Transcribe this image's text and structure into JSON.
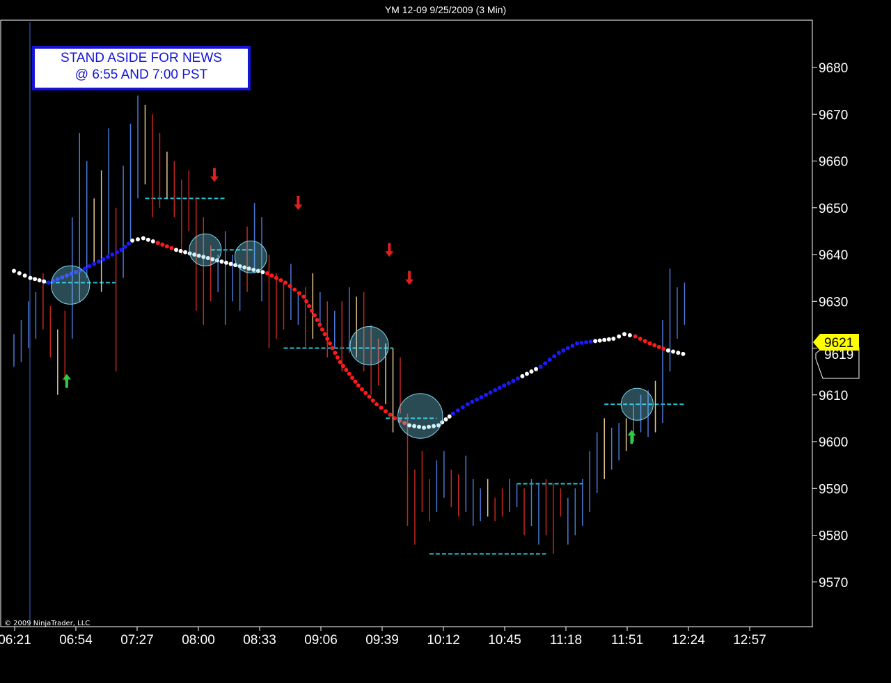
{
  "header": {
    "title": "YM 12-09  9/25/2009 (3 Min)"
  },
  "annotation": {
    "line1": "STAND ASIDE FOR NEWS",
    "line2": "@ 6:55 AND 7:00 PST"
  },
  "copyright": "© 2009 NinjaTrader, LLC",
  "price_tags": {
    "last": "9621",
    "secondary": "9619"
  },
  "colors": {
    "background": "#000000",
    "up_bar": "#4a78d8",
    "down_bar": "#c4281c",
    "neutral_bar": "#e8c890",
    "ma_up": "#1a1aff",
    "ma_down": "#ff1a1a",
    "ma_flat": "#ffffff",
    "level_line": "#1fc8d8",
    "circle": "#7ad8f0",
    "buy_arrow": "#2ecc40",
    "sell_arrow": "#e02020",
    "price_tag": "#ffff00"
  },
  "chart_data": {
    "type": "bar",
    "title": "YM 12-09  9/25/2009 (3 Min)",
    "x_ticks": [
      "06:21",
      "06:54",
      "07:27",
      "08:00",
      "08:33",
      "09:06",
      "09:39",
      "10:12",
      "10:45",
      "11:18",
      "11:51",
      "12:24",
      "12:57"
    ],
    "y_ticks": [
      9570,
      9580,
      9590,
      9600,
      9610,
      9620,
      9630,
      9640,
      9650,
      9660,
      9670,
      9680
    ],
    "ylim": [
      9560,
      9690
    ],
    "xlim_minutes": [
      381,
      805
    ],
    "grid": false,
    "moving_average": {
      "points": [
        [
          381,
          9636.5
        ],
        [
          390,
          9635
        ],
        [
          400,
          9634
        ],
        [
          410,
          9635.5
        ],
        [
          420,
          9637
        ],
        [
          430,
          9639
        ],
        [
          440,
          9641
        ],
        [
          446,
          9643
        ],
        [
          452,
          9643.5
        ],
        [
          460,
          9642.5
        ],
        [
          470,
          9641
        ],
        [
          480,
          9640
        ],
        [
          490,
          9639
        ],
        [
          500,
          9638
        ],
        [
          510,
          9637
        ],
        [
          520,
          9636
        ],
        [
          530,
          9634
        ],
        [
          540,
          9631
        ],
        [
          546,
          9627
        ],
        [
          553,
          9622
        ],
        [
          560,
          9617
        ],
        [
          570,
          9612
        ],
        [
          580,
          9608
        ],
        [
          590,
          9605
        ],
        [
          598,
          9603.5
        ],
        [
          606,
          9603
        ],
        [
          614,
          9603.5
        ],
        [
          622,
          9606
        ],
        [
          630,
          9608
        ],
        [
          640,
          9610
        ],
        [
          650,
          9612
        ],
        [
          660,
          9614
        ],
        [
          670,
          9616
        ],
        [
          680,
          9619
        ],
        [
          690,
          9621
        ],
        [
          700,
          9621.5
        ],
        [
          710,
          9622
        ],
        [
          716,
          9623
        ],
        [
          722,
          9622.5
        ],
        [
          730,
          9621
        ],
        [
          740,
          9619.5
        ],
        [
          751,
          9618.5
        ]
      ],
      "segment_colors": [
        "ma_flat",
        "ma_flat",
        "ma_up",
        "ma_up",
        "ma_up",
        "ma_up",
        "ma_up",
        "ma_flat",
        "ma_flat",
        "ma_down",
        "ma_flat",
        "ma_flat",
        "ma_flat",
        "ma_flat",
        "ma_flat",
        "ma_down",
        "ma_down",
        "ma_down",
        "ma_down",
        "ma_down",
        "ma_down",
        "ma_down",
        "ma_down",
        "ma_down",
        "ma_flat",
        "ma_flat",
        "ma_flat",
        "ma_up",
        "ma_up",
        "ma_up",
        "ma_up",
        "ma_flat",
        "ma_up",
        "ma_up",
        "ma_up",
        "ma_flat",
        "ma_flat",
        "ma_flat",
        "ma_down",
        "ma_down",
        "ma_flat",
        "ma_flat"
      ]
    },
    "bars": [
      [
        381,
        9616,
        9623,
        "up"
      ],
      [
        385,
        9617,
        9626,
        "up"
      ],
      [
        389,
        9620,
        9630,
        "up"
      ],
      [
        393,
        9622,
        9632,
        "up"
      ],
      [
        397,
        9624,
        9636,
        "down"
      ],
      [
        401,
        9618,
        9629,
        "down"
      ],
      [
        405,
        9610,
        9624,
        "neutral"
      ],
      [
        409,
        9613,
        9628,
        "down"
      ],
      [
        413,
        9622,
        9648,
        "up"
      ],
      [
        417,
        9630,
        9666,
        "up"
      ],
      [
        421,
        9635,
        9660,
        "up"
      ],
      [
        425,
        9638,
        9652,
        "neutral"
      ],
      [
        429,
        9632,
        9658,
        "neutral"
      ],
      [
        433,
        9640,
        9667,
        "up"
      ],
      [
        437,
        9615,
        9650,
        "down"
      ],
      [
        441,
        9635,
        9659,
        "up"
      ],
      [
        445,
        9643,
        9668,
        "up"
      ],
      [
        449,
        9652,
        9674,
        "up"
      ],
      [
        453,
        9655,
        9672,
        "neutral"
      ],
      [
        457,
        9648,
        9670,
        "down"
      ],
      [
        461,
        9650,
        9666,
        "down"
      ],
      [
        465,
        9652,
        9662,
        "neutral"
      ],
      [
        469,
        9648,
        9660,
        "down"
      ],
      [
        473,
        9640,
        9656,
        "down"
      ],
      [
        477,
        9645,
        9658,
        "down"
      ],
      [
        481,
        9628,
        9652,
        "down"
      ],
      [
        485,
        9625,
        9648,
        "down"
      ],
      [
        489,
        9630,
        9642,
        "down"
      ],
      [
        493,
        9632,
        9640,
        "up"
      ],
      [
        497,
        9625,
        9645,
        "up"
      ],
      [
        501,
        9630,
        9640,
        "up"
      ],
      [
        505,
        9628,
        9638,
        "up"
      ],
      [
        509,
        9632,
        9646,
        "down"
      ],
      [
        513,
        9636,
        9651,
        "up"
      ],
      [
        517,
        9630,
        9648,
        "up"
      ],
      [
        521,
        9620,
        9640,
        "down"
      ],
      [
        525,
        9622,
        9636,
        "down"
      ],
      [
        529,
        9624,
        9634,
        "down"
      ],
      [
        533,
        9626,
        9638,
        "up"
      ],
      [
        537,
        9625,
        9632,
        "up"
      ],
      [
        541,
        9620,
        9633,
        "down"
      ],
      [
        545,
        9622,
        9636,
        "neutral"
      ],
      [
        549,
        9625,
        9632,
        "up"
      ],
      [
        553,
        9618,
        9630,
        "down"
      ],
      [
        557,
        9620,
        9628,
        "up"
      ],
      [
        561,
        9615,
        9630,
        "down"
      ],
      [
        565,
        9619,
        9633,
        "up"
      ],
      [
        569,
        9618,
        9631,
        "neutral"
      ],
      [
        573,
        9615,
        9632,
        "down"
      ],
      [
        577,
        9610,
        9625,
        "down"
      ],
      [
        581,
        9612,
        9622,
        "down"
      ],
      [
        585,
        9608,
        9621,
        "neutral"
      ],
      [
        589,
        9602,
        9620,
        "neutral"
      ],
      [
        593,
        9606,
        9618,
        "down"
      ],
      [
        597,
        9582,
        9606,
        "down"
      ],
      [
        601,
        9578,
        9594,
        "down"
      ],
      [
        605,
        9585,
        9598,
        "down"
      ],
      [
        609,
        9583,
        9592,
        "down"
      ],
      [
        613,
        9585,
        9596,
        "up"
      ],
      [
        617,
        9588,
        9598,
        "up"
      ],
      [
        621,
        9586,
        9594,
        "down"
      ],
      [
        625,
        9584,
        9593,
        "down"
      ],
      [
        629,
        9585,
        9597,
        "up"
      ],
      [
        633,
        9582,
        9592,
        "up"
      ],
      [
        637,
        9583,
        9590,
        "up"
      ],
      [
        641,
        9584,
        9592,
        "neutral"
      ],
      [
        645,
        9583,
        9588,
        "down"
      ],
      [
        649,
        9584,
        9590,
        "down"
      ],
      [
        653,
        9585,
        9592,
        "up"
      ],
      [
        657,
        9586,
        9591,
        "up"
      ],
      [
        661,
        9580,
        9590,
        "down"
      ],
      [
        665,
        9582,
        9592,
        "up"
      ],
      [
        669,
        9578,
        9591,
        "up"
      ],
      [
        673,
        9580,
        9592,
        "down"
      ],
      [
        677,
        9576,
        9591,
        "down"
      ],
      [
        681,
        9584,
        9590,
        "down"
      ],
      [
        685,
        9578,
        9588,
        "up"
      ],
      [
        689,
        9580,
        9590,
        "up"
      ],
      [
        693,
        9582,
        9592,
        "up"
      ],
      [
        697,
        9585,
        9598,
        "up"
      ],
      [
        701,
        9589,
        9602,
        "up"
      ],
      [
        705,
        9592,
        9605,
        "neutral"
      ],
      [
        709,
        9594,
        9603,
        "up"
      ],
      [
        713,
        9596,
        9604,
        "up"
      ],
      [
        717,
        9598,
        9605,
        "neutral"
      ],
      [
        721,
        9600,
        9608,
        "up"
      ],
      [
        725,
        9602,
        9610,
        "up"
      ],
      [
        729,
        9601,
        9611,
        "up"
      ],
      [
        733,
        9602,
        9613,
        "neutral"
      ],
      [
        737,
        9604,
        9626,
        "up"
      ],
      [
        741,
        9615,
        9637,
        "up"
      ],
      [
        745,
        9622,
        9633,
        "up"
      ],
      [
        749,
        9625,
        9634,
        "up"
      ]
    ],
    "levels": [
      [
        397,
        9634,
        437
      ],
      [
        453,
        9652,
        497
      ],
      [
        489,
        9641,
        513
      ],
      [
        529,
        9620,
        589
      ],
      [
        585,
        9605,
        613
      ],
      [
        609,
        9576,
        673
      ],
      [
        657,
        9591,
        693
      ],
      [
        705,
        9608,
        749
      ]
    ],
    "circles": [
      [
        412,
        9633.5,
        12
      ],
      [
        486,
        9641,
        10
      ],
      [
        511,
        9639.5,
        10
      ],
      [
        576,
        9620.5,
        12
      ],
      [
        604,
        9605.5,
        14
      ],
      [
        723,
        9608,
        10
      ]
    ],
    "buy_arrows": [
      [
        410,
        9613
      ],
      [
        720,
        9601
      ]
    ],
    "sell_arrows": [
      [
        491,
        9657
      ],
      [
        537,
        9651
      ],
      [
        587,
        9641
      ],
      [
        598,
        9635
      ]
    ]
  }
}
